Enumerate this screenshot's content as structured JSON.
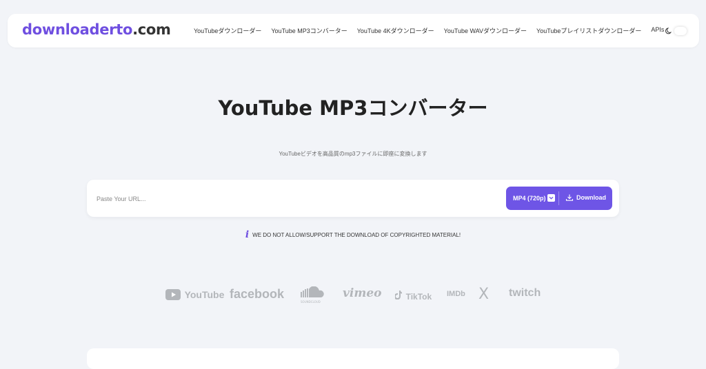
{
  "header": {
    "logo_brand": "downloaderto",
    "logo_tld": ".com",
    "nav": [
      "YouTubeダウンローダー",
      "YouTube MP3コンバーター",
      "YouTube 4Kダウンローダー",
      "YouTube WAVダウンローダー",
      "YouTubeプレイリストダウンローダー",
      "APIs"
    ]
  },
  "hero": {
    "title": "YouTube MP3コンバーター",
    "subtitle": "YouTubeビデオを高品質のmp3ファイルに即座に変換します"
  },
  "search": {
    "placeholder": "Paste Your URL...",
    "format_label": "MP4 (720p)",
    "download_label": "Download"
  },
  "notice": {
    "info_glyph": "i",
    "text": "WE DO NOT ALLOW/SUPPORT THE DOWNLOAD OF COPYRIGHTED MATERIAL!"
  },
  "platforms": [
    "YouTube",
    "facebook",
    "SOUNDCLOUD",
    "vimeo",
    "TikTok",
    "IMDb",
    "X",
    "twitch"
  ],
  "colors": {
    "accent": "#6e55e6",
    "background": "#f2f4f8",
    "logo_gray": "#b3b6ba"
  }
}
